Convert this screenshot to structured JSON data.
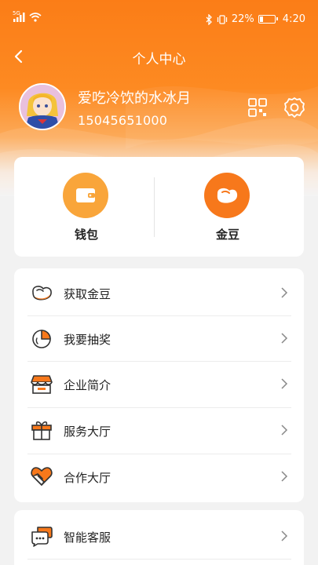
{
  "status_bar": {
    "network": "5G",
    "battery": "22%",
    "battery_level": 0.22,
    "time": "4:20"
  },
  "nav": {
    "title": "个人中心",
    "back_icon": "chevron-left-icon"
  },
  "profile": {
    "username": "爱吃冷饮的水冰月",
    "phone": "15045651000",
    "qr_icon": "qr-code-icon",
    "settings_icon": "gear-icon"
  },
  "wallet_section": {
    "items": [
      {
        "label": "钱包",
        "icon": "wallet-icon",
        "color": "#f9a53a"
      },
      {
        "label": "金豆",
        "icon": "bean-icon",
        "color": "#f7781b"
      }
    ]
  },
  "menu": {
    "items": [
      {
        "label": "获取金豆",
        "icon": "bean-icon"
      },
      {
        "label": "我要抽奖",
        "icon": "pie-chart-icon"
      },
      {
        "label": "企业简介",
        "icon": "store-icon"
      },
      {
        "label": "服务大厅",
        "icon": "gift-box-icon"
      },
      {
        "label": "合作大厅",
        "icon": "heart-handshake-icon"
      }
    ]
  },
  "menu2": {
    "items": [
      {
        "label": "智能客服",
        "icon": "chat-bubble-icon"
      }
    ]
  },
  "colors": {
    "accent": "#fb7d17",
    "icon_fill": "#f7781b",
    "icon_stroke": "#333333"
  }
}
